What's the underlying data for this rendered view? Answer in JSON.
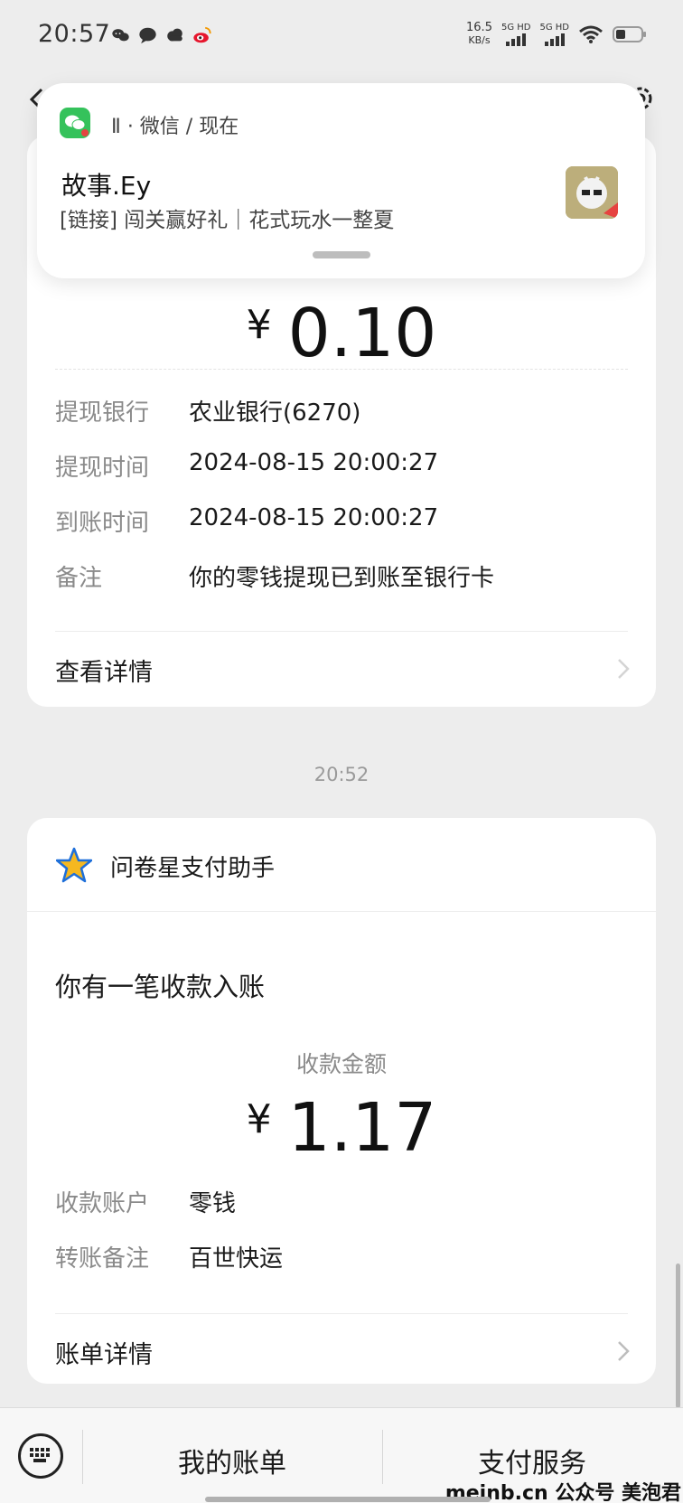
{
  "status_bar": {
    "time": "20:57",
    "net_speed_value": "16.5",
    "net_speed_unit": "KB/s",
    "sim1_label": "5G HD",
    "sim2_label": "5G HD",
    "icons": [
      "chat-bubbles-icon",
      "chat-icon",
      "cloud-icon",
      "weibo-icon",
      "wifi-icon",
      "battery-icon"
    ]
  },
  "notification": {
    "app_line": "Ⅱ · 微信 / 现在",
    "title": "故事.Ey",
    "body": "[链接] 闯关赢好礼｜花式玩水一整夏"
  },
  "withdrawal_card": {
    "currency": "¥",
    "amount": "0.10",
    "rows": [
      {
        "label": "提现银行",
        "value": "农业银行(6270)"
      },
      {
        "label": "提现时间",
        "value": "2024-08-15 20:00:27"
      },
      {
        "label": "到账时间",
        "value": "2024-08-15 20:00:27"
      },
      {
        "label": "备注",
        "value": "你的零钱提现已到账至银行卡"
      }
    ],
    "details_link": "查看详情"
  },
  "time_divider": "20:52",
  "receipt_card": {
    "sender": "问卷星支付助手",
    "title": "你有一笔收款入账",
    "amount_label": "收款金额",
    "currency": "¥",
    "amount": "1.17",
    "rows": [
      {
        "label": "收款账户",
        "value": "零钱"
      },
      {
        "label": "转账备注",
        "value": "百世快运"
      }
    ],
    "details_link": "账单详情"
  },
  "bottom_bar": {
    "tab1": "我的账单",
    "tab2": "支付服务",
    "watermark": "meinb.cn  公众号 美泡君"
  },
  "colors": {
    "wechat_green": "#35c25b",
    "background": "#ededed",
    "star_blue": "#1e6fd9",
    "star_yellow": "#f5b820"
  }
}
